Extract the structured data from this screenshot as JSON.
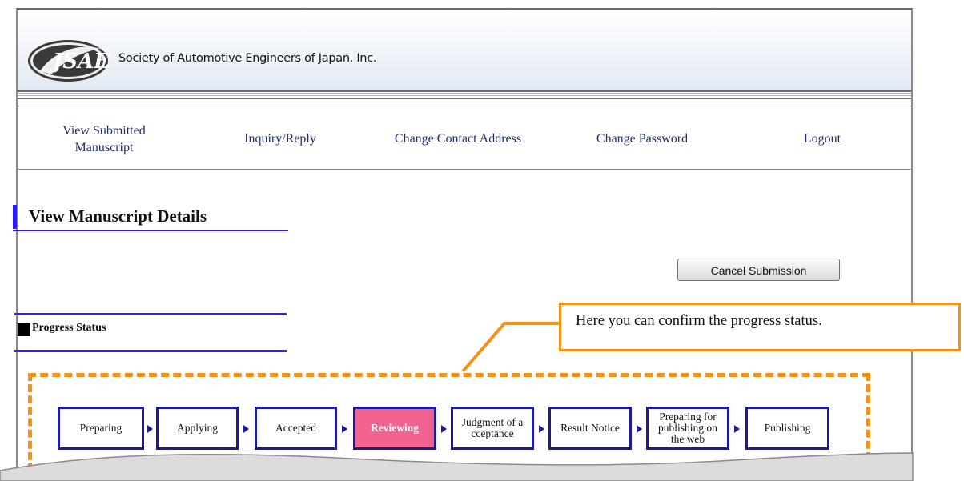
{
  "header": {
    "org_name": "Society of Automotive Engineers of Japan. Inc.",
    "logo_text": "JSAE"
  },
  "nav": {
    "items": [
      {
        "line1": "View Submitted",
        "line2": "Manuscript"
      },
      {
        "line1": "Inquiry/Reply",
        "line2": ""
      },
      {
        "line1": "Change Contact Address",
        "line2": ""
      },
      {
        "line1": "Change Password",
        "line2": ""
      },
      {
        "line1": "Logout",
        "line2": ""
      }
    ]
  },
  "page": {
    "title": "View Manuscript Details",
    "cancel_button": "Cancel Submission",
    "progress_heading": "Progress Status"
  },
  "progress": {
    "active_index": 3,
    "steps": [
      {
        "line1": "Preparing",
        "line2": "",
        "line3": ""
      },
      {
        "line1": "Applying",
        "line2": "",
        "line3": ""
      },
      {
        "line1": "Accepted",
        "line2": "",
        "line3": ""
      },
      {
        "line1": "Reviewing",
        "line2": "",
        "line3": ""
      },
      {
        "line1": "Judgment of a",
        "line2": "cceptance",
        "line3": ""
      },
      {
        "line1": "Result Notice",
        "line2": "",
        "line3": ""
      },
      {
        "line1": "Preparing for",
        "line2": "publishing on",
        "line3": "the web"
      },
      {
        "line1": "Publishing",
        "line2": "",
        "line3": ""
      }
    ]
  },
  "callout": {
    "text": "Here you can confirm the progress status."
  },
  "colors": {
    "accent": "#2a1cff",
    "nav_text": "#1f2d6a",
    "active_step": "#f0648f",
    "step_border": "#1a1a9e",
    "annotation": "#f39217"
  }
}
